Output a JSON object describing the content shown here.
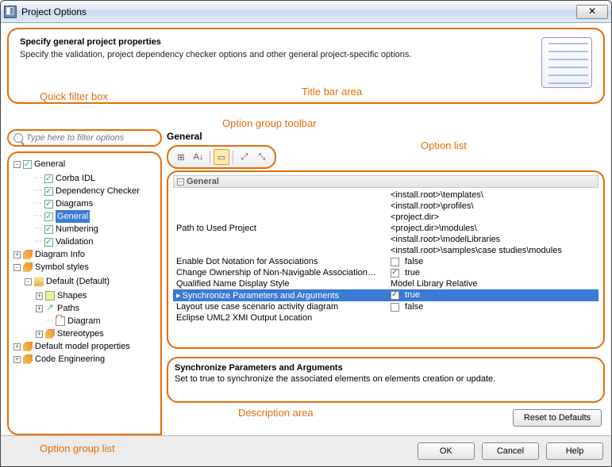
{
  "window": {
    "title": "Project Options"
  },
  "header": {
    "title": "Specify general project properties",
    "subtitle": "Specify the validation, project dependency checker options and other general project-specific options."
  },
  "callouts": {
    "title_bar": "Title bar area",
    "filter": "Quick filter box",
    "toolbar": "Option group toolbar",
    "option_list": "Option list",
    "option_group_list": "Option group list",
    "description": "Description area"
  },
  "filter": {
    "placeholder": "Type here to filter options"
  },
  "tree": {
    "root": [
      {
        "label": "General",
        "exp": "-",
        "chk": true,
        "children": [
          {
            "label": "Corba IDL",
            "chk": true
          },
          {
            "label": "Dependency Checker",
            "chk": true
          },
          {
            "label": "Diagrams",
            "chk": true
          },
          {
            "label": "General",
            "chk": true,
            "selected": true
          },
          {
            "label": "Numbering",
            "chk": true
          },
          {
            "label": "Validation",
            "chk": true
          }
        ]
      },
      {
        "label": "Diagram Info",
        "exp": "+",
        "icon": "tag"
      },
      {
        "label": "Symbol styles",
        "exp": "-",
        "icon": "tag",
        "children": [
          {
            "label": "Default (Default)",
            "exp": "-",
            "icon": "folder",
            "children": [
              {
                "label": "Shapes",
                "exp": "+",
                "icon": "square"
              },
              {
                "label": "Paths",
                "exp": "+",
                "icon": "arrow"
              },
              {
                "label": "Diagram",
                "icon": "pkg"
              },
              {
                "label": "Stereotypes",
                "exp": "+",
                "icon": "tag"
              }
            ]
          }
        ]
      },
      {
        "label": "Default model properties",
        "exp": "+",
        "icon": "tag"
      },
      {
        "label": "Code Engineering",
        "exp": "+",
        "icon": "tag"
      }
    ]
  },
  "group": {
    "title": "General",
    "section_label": "General"
  },
  "toolbar_icons": [
    "categorize-icon",
    "sort-az-icon",
    "view-mode-icon",
    "expand-all-icon",
    "collapse-all-icon"
  ],
  "options": [
    {
      "name": "Path to Used Project",
      "value_multi": [
        "<install.root>\\templates\\",
        "<install.root>\\profiles\\",
        "<project.dir>",
        "<project.dir>\\modules\\",
        "<install.root>\\modelLibraries",
        "<install.root>\\samples\\case studies\\modules"
      ]
    },
    {
      "name": "Enable Dot Notation for Associations",
      "value_bool": false,
      "display": "false"
    },
    {
      "name": "Change Ownership of Non-Navigable Association…",
      "value_bool": true,
      "display": "true"
    },
    {
      "name": "Qualified Name Display Style",
      "value_text": "Model Library Relative"
    },
    {
      "name": "Synchronize Parameters and Arguments",
      "value_bool": true,
      "display": "true",
      "selected": true
    },
    {
      "name": "Layout use case scenario activity diagram",
      "value_bool": false,
      "display": "false"
    },
    {
      "name": "Eclipse UML2 XMI Output Location",
      "value_text": ""
    }
  ],
  "description": {
    "title": "Synchronize Parameters and Arguments",
    "body": "Set to true to synchronize the associated elements on elements creation or update."
  },
  "buttons": {
    "reset": "Reset to Defaults",
    "ok": "OK",
    "cancel": "Cancel",
    "help": "Help"
  }
}
